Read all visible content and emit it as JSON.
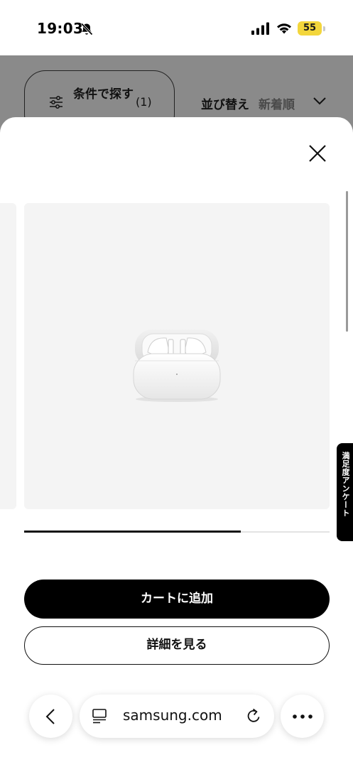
{
  "status_bar": {
    "time": "19:03",
    "battery": "55",
    "icons": [
      "bell-off-icon",
      "signal-icon",
      "wifi-icon",
      "battery-icon"
    ]
  },
  "background_page": {
    "filter": {
      "label": "条件で探す",
      "count": "(1)"
    },
    "sort": {
      "label": "並び替え",
      "value": "新着順"
    }
  },
  "modal": {
    "carousel": {
      "progress": 0.71
    },
    "add_to_cart_label": "カートに追加",
    "details_label": "詳細を見る"
  },
  "survey_tab": {
    "label": "満足度アンケート"
  },
  "browser": {
    "url": "samsung.com",
    "icons": [
      "back-icon",
      "reader-icon",
      "reload-icon",
      "more-icon"
    ]
  },
  "colors": {
    "overlay": "#8a8a8a",
    "battery": "#f3d63c",
    "primary_button": "#000000",
    "image_background": "#f4f4f4"
  }
}
